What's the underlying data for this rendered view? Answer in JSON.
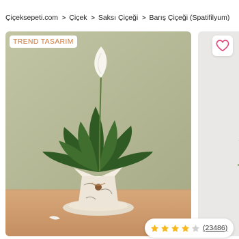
{
  "breadcrumb": {
    "items": [
      "Çiçeksepeti.com",
      "Çiçek",
      "Saksı Çiçeği",
      "Barış Çiçeği (Spatifilyum)"
    ],
    "separator": ">"
  },
  "product": {
    "badge": "TREND TASARIM",
    "favorite_icon": "heart-outline-icon",
    "rating": {
      "value": 4,
      "max": 5,
      "count_text": "(23486)"
    }
  },
  "colors": {
    "badge_text": "#c8763a",
    "heart": "#e0457b",
    "star_filled": "#f6b81d",
    "star_empty": "#d0d0d0"
  }
}
